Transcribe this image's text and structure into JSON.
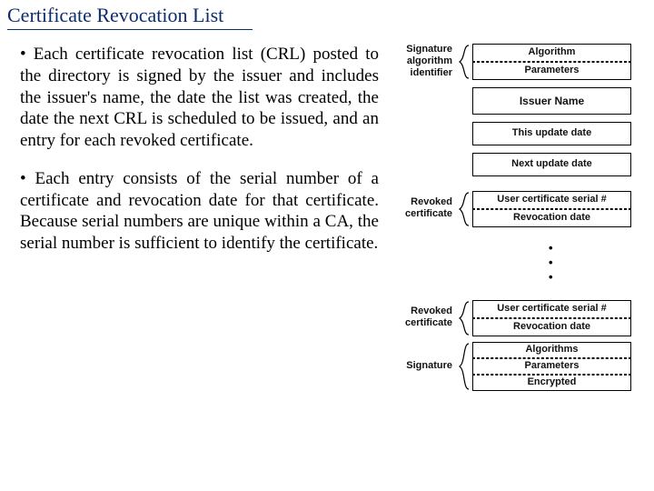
{
  "title": "Certificate Revocation List",
  "paragraphs": {
    "p1": "• Each certificate revocation list (CRL) posted to the directory is signed by the issuer and includes the issuer's name, the date the list was created, the date the next CRL is scheduled to be issued, and an entry for each revoked certificate.",
    "p2": "• Each entry consists of the serial number of a certificate and revocation date for that certificate. Because serial numbers are unique within a CA, the serial number is sufficient to identify the certificate."
  },
  "diagram": {
    "labels": {
      "sig_algo_id_l1": "Signature",
      "sig_algo_id_l2": "algorithm",
      "sig_algo_id_l3": "identifier",
      "revoked_cert_l1": "Revoked",
      "revoked_cert_l2": "certificate",
      "revoked_cert2_l1": "Revoked",
      "revoked_cert2_l2": "certificate",
      "signature": "Signature"
    },
    "cells": {
      "algorithm": "Algorithm",
      "parameters": "Parameters",
      "issuer_name": "Issuer Name",
      "this_update": "This update date",
      "next_update": "Next update date",
      "user_cert_serial": "User certificate serial #",
      "revocation_date": "Revocation date",
      "user_cert_serial2": "User certificate serial #",
      "revocation_date2": "Revocation date",
      "sig_algorithms": "Algorithms",
      "sig_parameters": "Parameters",
      "sig_encrypted": "Encrypted"
    },
    "dots": {
      "d1": "•",
      "d2": "•",
      "d3": "•"
    }
  }
}
